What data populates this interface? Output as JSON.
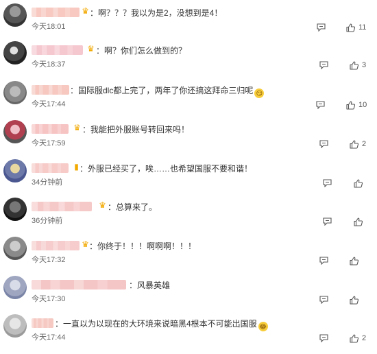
{
  "comments": [
    {
      "text": "：啊？？？我以为是2，没想到是4！",
      "time": "今天18:01",
      "likes": "11",
      "badge": "crown-icon",
      "emoji": ""
    },
    {
      "text": "：啊？你们怎么做到的？",
      "time": "今天18:37",
      "likes": "3",
      "badge": "crown-icon",
      "emoji": ""
    },
    {
      "text": "：国际服dlc都上完了，两年了你还搞这拜命三归呢",
      "time": "今天17:44",
      "likes": "10",
      "badge": "",
      "emoji": "smirk-emoji"
    },
    {
      "text": "：我能把外服账号转回来吗！",
      "time": "今天17:59",
      "likes": "2",
      "badge": "crown-icon",
      "emoji": ""
    },
    {
      "text": "：外服已经买了，唉……也希望国服不要和谐！",
      "time": "34分钟前",
      "likes": "",
      "badge": "flag-icon",
      "emoji": ""
    },
    {
      "text": "：总算来了。",
      "time": "36分钟前",
      "likes": "",
      "badge": "crown-icon",
      "emoji": ""
    },
    {
      "text": "：你终于！！！啊啊啊！！！",
      "time": "今天17:32",
      "likes": "",
      "badge": "crown-icon",
      "emoji": ""
    },
    {
      "text": "：风暴英雄",
      "time": "今天17:30",
      "likes": "",
      "badge": "",
      "emoji": ""
    },
    {
      "text": "：一直以为以现在的大环境来说暗黑4根本不可能出国服",
      "time": "今天17:44",
      "likes": "2",
      "badge": "",
      "emoji": "laugh-emoji"
    }
  ],
  "colors": {
    "accent": "#f2a900",
    "time": "#666666",
    "text": "#333333"
  }
}
